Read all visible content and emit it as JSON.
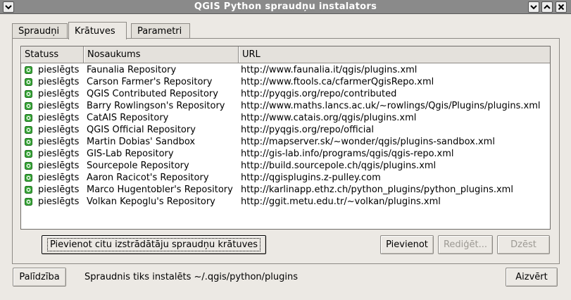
{
  "window": {
    "title": "QGIS Python spraudņu instalators"
  },
  "tabs": [
    {
      "label": "Spraudņi"
    },
    {
      "label": "Krātuves"
    },
    {
      "label": "Parametri"
    }
  ],
  "table": {
    "columns": [
      "Statuss",
      "Nosaukums",
      "URL"
    ],
    "rows": [
      {
        "status": "pieslēgts",
        "name": "Faunalia Repository",
        "url": "http://www.faunalia.it/qgis/plugins.xml"
      },
      {
        "status": "pieslēgts",
        "name": "Carson Farmer's Repository",
        "url": "http://www.ftools.ca/cfarmerQgisRepo.xml"
      },
      {
        "status": "pieslēgts",
        "name": "QGIS Contributed Repository",
        "url": "http://pyqgis.org/repo/contributed"
      },
      {
        "status": "pieslēgts",
        "name": "Barry Rowlingson's Repository",
        "url": "http://www.maths.lancs.ac.uk/~rowlings/Qgis/Plugins/plugins.xml"
      },
      {
        "status": "pieslēgts",
        "name": "CatAIS Repository",
        "url": "http://www.catais.org/qgis/plugins.xml"
      },
      {
        "status": "pieslēgts",
        "name": "QGIS Official Repository",
        "url": "http://pyqgis.org/repo/official"
      },
      {
        "status": "pieslēgts",
        "name": "Martin Dobias' Sandbox",
        "url": "http://mapserver.sk/~wonder/qgis/plugins-sandbox.xml"
      },
      {
        "status": "pieslēgts",
        "name": "GIS-Lab Repository",
        "url": "http://gis-lab.info/programs/qgis/qgis-repo.xml"
      },
      {
        "status": "pieslēgts",
        "name": "Sourcepole Repository",
        "url": "http://build.sourcepole.ch/qgis/plugins.xml"
      },
      {
        "status": "pieslēgts",
        "name": "Aaron Racicot's Repository",
        "url": "http://qgisplugins.z-pulley.com"
      },
      {
        "status": "pieslēgts",
        "name": "Marco Hugentobler's Repository",
        "url": "http://karlinapp.ethz.ch/python_plugins/python_plugins.xml"
      },
      {
        "status": "pieslēgts",
        "name": "Volkan Kepoglu's Repository",
        "url": "http://ggit.metu.edu.tr/~volkan/plugins.xml"
      }
    ]
  },
  "buttons": {
    "add_third_party": "Pievienot citu izstrādātāju spraudņu krātuves",
    "add": "Pievienot",
    "edit": "Rediģēt...",
    "delete": "Dzēst",
    "help": "Palīdzība",
    "close": "Aizvērt"
  },
  "footer": {
    "install_path_text": "Spraudnis tiks instalēts ~/.qgis/python/plugins"
  },
  "colors": {
    "status_connected": "#3aa83a",
    "titlebar": "#8a8a8a"
  }
}
